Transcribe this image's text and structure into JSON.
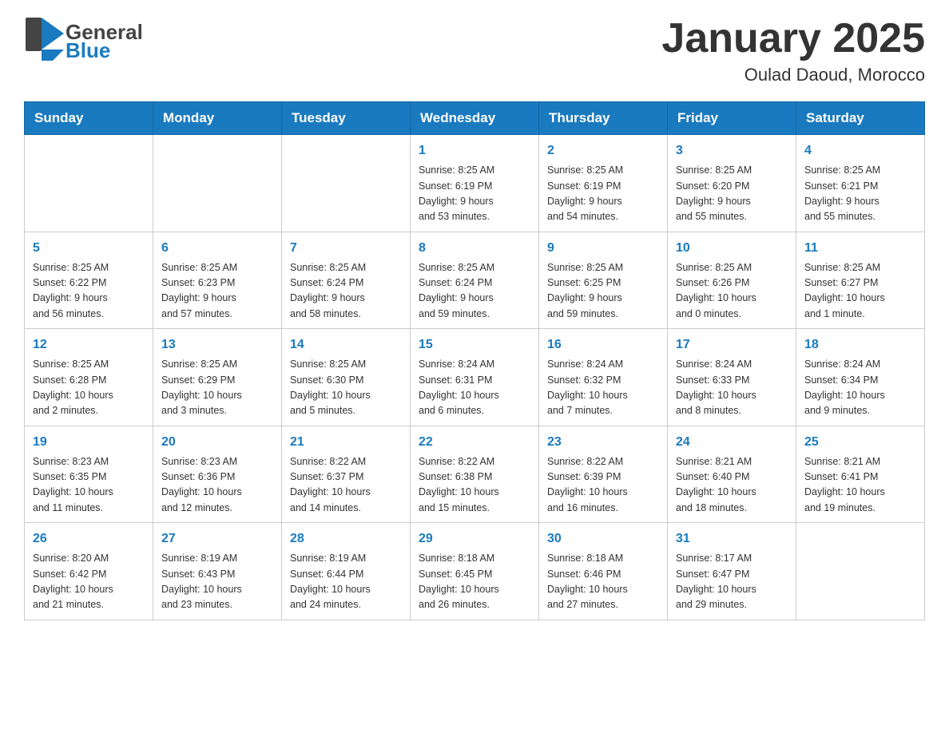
{
  "header": {
    "logo_general": "General",
    "logo_blue": "Blue",
    "title": "January 2025",
    "subtitle": "Oulad Daoud, Morocco"
  },
  "days_of_week": [
    "Sunday",
    "Monday",
    "Tuesday",
    "Wednesday",
    "Thursday",
    "Friday",
    "Saturday"
  ],
  "weeks": [
    [
      {
        "day": "",
        "info": ""
      },
      {
        "day": "",
        "info": ""
      },
      {
        "day": "",
        "info": ""
      },
      {
        "day": "1",
        "info": "Sunrise: 8:25 AM\nSunset: 6:19 PM\nDaylight: 9 hours\nand 53 minutes."
      },
      {
        "day": "2",
        "info": "Sunrise: 8:25 AM\nSunset: 6:19 PM\nDaylight: 9 hours\nand 54 minutes."
      },
      {
        "day": "3",
        "info": "Sunrise: 8:25 AM\nSunset: 6:20 PM\nDaylight: 9 hours\nand 55 minutes."
      },
      {
        "day": "4",
        "info": "Sunrise: 8:25 AM\nSunset: 6:21 PM\nDaylight: 9 hours\nand 55 minutes."
      }
    ],
    [
      {
        "day": "5",
        "info": "Sunrise: 8:25 AM\nSunset: 6:22 PM\nDaylight: 9 hours\nand 56 minutes."
      },
      {
        "day": "6",
        "info": "Sunrise: 8:25 AM\nSunset: 6:23 PM\nDaylight: 9 hours\nand 57 minutes."
      },
      {
        "day": "7",
        "info": "Sunrise: 8:25 AM\nSunset: 6:24 PM\nDaylight: 9 hours\nand 58 minutes."
      },
      {
        "day": "8",
        "info": "Sunrise: 8:25 AM\nSunset: 6:24 PM\nDaylight: 9 hours\nand 59 minutes."
      },
      {
        "day": "9",
        "info": "Sunrise: 8:25 AM\nSunset: 6:25 PM\nDaylight: 9 hours\nand 59 minutes."
      },
      {
        "day": "10",
        "info": "Sunrise: 8:25 AM\nSunset: 6:26 PM\nDaylight: 10 hours\nand 0 minutes."
      },
      {
        "day": "11",
        "info": "Sunrise: 8:25 AM\nSunset: 6:27 PM\nDaylight: 10 hours\nand 1 minute."
      }
    ],
    [
      {
        "day": "12",
        "info": "Sunrise: 8:25 AM\nSunset: 6:28 PM\nDaylight: 10 hours\nand 2 minutes."
      },
      {
        "day": "13",
        "info": "Sunrise: 8:25 AM\nSunset: 6:29 PM\nDaylight: 10 hours\nand 3 minutes."
      },
      {
        "day": "14",
        "info": "Sunrise: 8:25 AM\nSunset: 6:30 PM\nDaylight: 10 hours\nand 5 minutes."
      },
      {
        "day": "15",
        "info": "Sunrise: 8:24 AM\nSunset: 6:31 PM\nDaylight: 10 hours\nand 6 minutes."
      },
      {
        "day": "16",
        "info": "Sunrise: 8:24 AM\nSunset: 6:32 PM\nDaylight: 10 hours\nand 7 minutes."
      },
      {
        "day": "17",
        "info": "Sunrise: 8:24 AM\nSunset: 6:33 PM\nDaylight: 10 hours\nand 8 minutes."
      },
      {
        "day": "18",
        "info": "Sunrise: 8:24 AM\nSunset: 6:34 PM\nDaylight: 10 hours\nand 9 minutes."
      }
    ],
    [
      {
        "day": "19",
        "info": "Sunrise: 8:23 AM\nSunset: 6:35 PM\nDaylight: 10 hours\nand 11 minutes."
      },
      {
        "day": "20",
        "info": "Sunrise: 8:23 AM\nSunset: 6:36 PM\nDaylight: 10 hours\nand 12 minutes."
      },
      {
        "day": "21",
        "info": "Sunrise: 8:22 AM\nSunset: 6:37 PM\nDaylight: 10 hours\nand 14 minutes."
      },
      {
        "day": "22",
        "info": "Sunrise: 8:22 AM\nSunset: 6:38 PM\nDaylight: 10 hours\nand 15 minutes."
      },
      {
        "day": "23",
        "info": "Sunrise: 8:22 AM\nSunset: 6:39 PM\nDaylight: 10 hours\nand 16 minutes."
      },
      {
        "day": "24",
        "info": "Sunrise: 8:21 AM\nSunset: 6:40 PM\nDaylight: 10 hours\nand 18 minutes."
      },
      {
        "day": "25",
        "info": "Sunrise: 8:21 AM\nSunset: 6:41 PM\nDaylight: 10 hours\nand 19 minutes."
      }
    ],
    [
      {
        "day": "26",
        "info": "Sunrise: 8:20 AM\nSunset: 6:42 PM\nDaylight: 10 hours\nand 21 minutes."
      },
      {
        "day": "27",
        "info": "Sunrise: 8:19 AM\nSunset: 6:43 PM\nDaylight: 10 hours\nand 23 minutes."
      },
      {
        "day": "28",
        "info": "Sunrise: 8:19 AM\nSunset: 6:44 PM\nDaylight: 10 hours\nand 24 minutes."
      },
      {
        "day": "29",
        "info": "Sunrise: 8:18 AM\nSunset: 6:45 PM\nDaylight: 10 hours\nand 26 minutes."
      },
      {
        "day": "30",
        "info": "Sunrise: 8:18 AM\nSunset: 6:46 PM\nDaylight: 10 hours\nand 27 minutes."
      },
      {
        "day": "31",
        "info": "Sunrise: 8:17 AM\nSunset: 6:47 PM\nDaylight: 10 hours\nand 29 minutes."
      },
      {
        "day": "",
        "info": ""
      }
    ]
  ]
}
